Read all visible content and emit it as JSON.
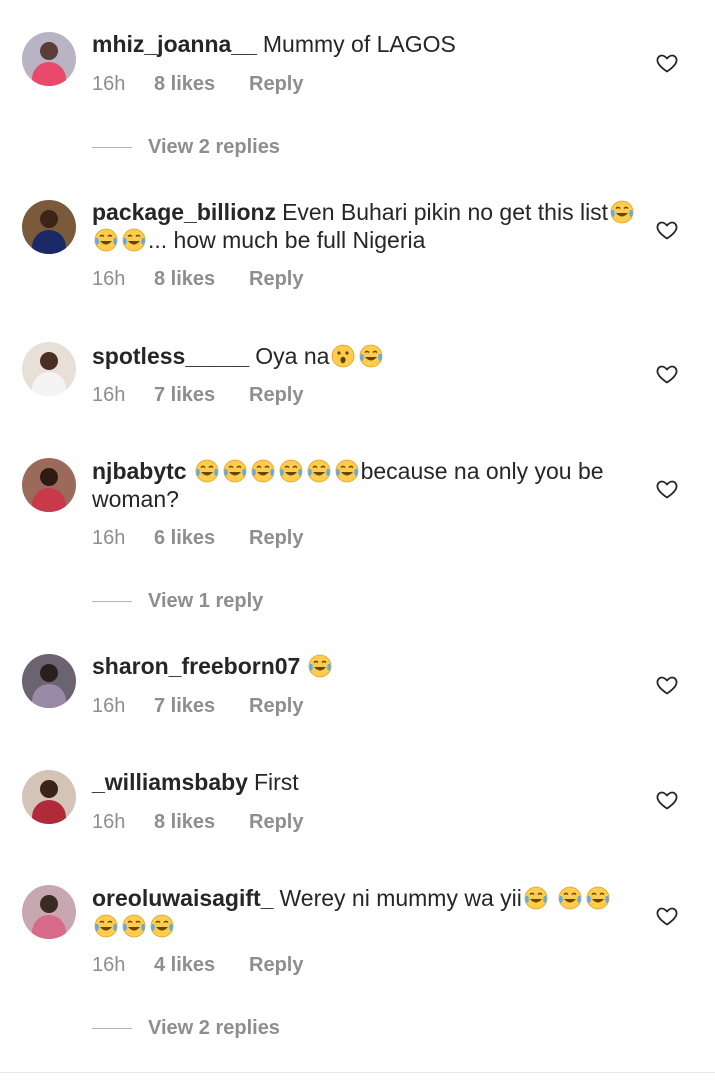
{
  "comments": [
    {
      "username": "mhiz_joanna__",
      "text": "Mummy of LAGOS",
      "time": "16h",
      "likes": "8 likes",
      "reply": "Reply",
      "view_replies": "View 2 replies"
    },
    {
      "username": "package_billionz",
      "text_before": "Even Buhari pikin no get this list",
      "text_after": "... how much be full Nigeria",
      "emojis": [
        "tears-of-joy",
        "tears-of-joy",
        "tears-of-joy"
      ],
      "time": "16h",
      "likes": "8 likes",
      "reply": "Reply"
    },
    {
      "username": "spotless_____",
      "text": "Oya na",
      "emojis": [
        "astonished-face",
        "tears-of-joy"
      ],
      "time": "16h",
      "likes": "7 likes",
      "reply": "Reply"
    },
    {
      "username": "njbabytc",
      "text_after": "because na only you be woman?",
      "emojis": [
        "tears-of-joy",
        "tears-of-joy",
        "tears-of-joy",
        "tears-of-joy",
        "tears-of-joy",
        "tears-of-joy"
      ],
      "time": "16h",
      "likes": "6 likes",
      "reply": "Reply",
      "view_replies": "View 1 reply"
    },
    {
      "username": "sharon_freeborn07",
      "emojis": [
        "tears-of-joy"
      ],
      "time": "16h",
      "likes": "7 likes",
      "reply": "Reply"
    },
    {
      "username": "_williamsbaby",
      "text": "First",
      "time": "16h",
      "likes": "8 likes",
      "reply": "Reply"
    },
    {
      "username": "oreoluwaisagift_",
      "text": "Werey ni mummy wa yii",
      "emojis": [
        "tears-of-joy",
        "tears-of-joy",
        "tears-of-joy",
        "tears-of-joy",
        "tears-of-joy",
        "tears-of-joy"
      ],
      "time": "16h",
      "likes": "4 likes",
      "reply": "Reply",
      "view_replies": "View 2 replies"
    }
  ],
  "colors": {
    "text": "#262626",
    "secondary": "#8e8e8e",
    "emoji_face": "#ffcc4d"
  },
  "icons": {
    "like": "heart-outline-icon"
  }
}
